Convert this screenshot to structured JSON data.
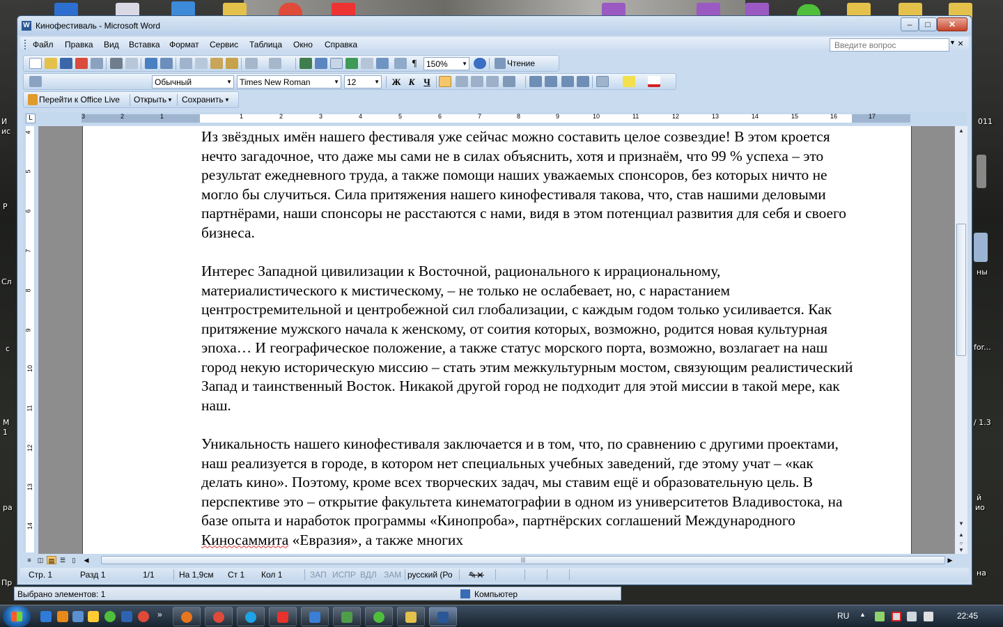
{
  "window": {
    "title": "Кинофестиваль - Microsoft Word",
    "app_icon": "W",
    "minimize": "–",
    "maximize": "□",
    "close": "✕"
  },
  "menu": {
    "items": [
      "Файл",
      "Правка",
      "Вид",
      "Вставка",
      "Формат",
      "Сервис",
      "Таблица",
      "Окно",
      "Справка"
    ],
    "ask_placeholder": "Введите вопрос",
    "close": "×"
  },
  "toolbar": {
    "zoom": "150%",
    "read_label": "Чтение",
    "style": "Обычный",
    "font": "Times New Roman",
    "size": "12",
    "bold": "Ж",
    "italic": "К",
    "underline": "Ч",
    "office_live": "Перейти к Office Live",
    "open": "Открыть",
    "save": "Сохранить"
  },
  "ruler": {
    "corner": "L",
    "top_numbers": [
      "3",
      "2",
      "1",
      "1",
      "2",
      "3",
      "4",
      "5",
      "6",
      "7",
      "8",
      "9",
      "10",
      "11",
      "12",
      "13",
      "14",
      "15",
      "16",
      "17"
    ],
    "left_numbers": [
      "4",
      "5",
      "6",
      "7",
      "8",
      "9",
      "10",
      "11",
      "12",
      "13",
      "14"
    ]
  },
  "document": {
    "paragraphs": [
      "Из звёздных имён нашего фестиваля уже сейчас можно составить целое созвездие! В этом кроется нечто загадочное, что даже мы сами не в силах объяснить, хотя и признаём, что 99 % успеха – это результат ежедневного труда, а также помощи наших уважаемых спонсоров, без которых ничто не могло бы случиться. Сила притяжения нашего кинофестиваля такова, что, став нашими деловыми партнёрами, наши спонсоры не расстаются с нами, видя в этом потенциал развития для себя и своего бизнеса.",
      "Интерес Западной цивилизации к Восточной, рационального к иррациональному, материалистического к мистическому, – не только не ослабевает, но, с нарастанием центростремительной и центробежной сил глобализации, с каждым годом только усиливается. Как притяжение мужского начала к женскому, от соития которых, возможно, родится новая культурная эпоха… И географическое положение, а также статус морского порта, возможно, возлагает на наш город некую историческую миссию – стать этим межкультурным мостом, связующим реалистический Запад и таинственный Восток. Никакой другой город не подходит для этой миссии в такой мере, как наш."
    ],
    "p3_before": "Уникальность нашего кинофестиваля заключается и в том, что, по сравнению с другими проектами, наш реализуется в городе, в котором нет специальных учебных заведений, где этому учат – «как делать кино». Поэтому, кроме всех творческих задач, мы ставим ещё и образовательную цель. В перспективе это – открытие факультета кинематографии в одном из университетов Владивостока, на базе опыта и наработок программы «Кинопроба», партнёрских соглашений Международного ",
    "p3_error": "Киносаммита",
    "p3_after": " «Евразия», а также многих"
  },
  "statusbar": {
    "page": "Стр. 1",
    "section": "Разд 1",
    "pages": "1/1",
    "at": "На 1,9см",
    "line": "Ст 1",
    "col": "Кол 1",
    "rec": "ЗАП",
    "trk": "ИСПР",
    "ext": "ВДЛ",
    "ovr": "ЗАМ",
    "lang": "русский (Ро"
  },
  "explorer": {
    "selected": "Выбрано элементов: 1",
    "computer": "Компьютер"
  },
  "taskbar": {
    "lang": "RU",
    "time": "22:45",
    "more": "»"
  },
  "desktop": {
    "edge_labels": [
      "И",
      "ис",
      "Р",
      "Сл",
      "с",
      "М",
      "1",
      "ра",
      "Пр",
      "011",
      "ны",
      "for...",
      "/ 1.3",
      "й",
      "ио",
      "на"
    ]
  }
}
